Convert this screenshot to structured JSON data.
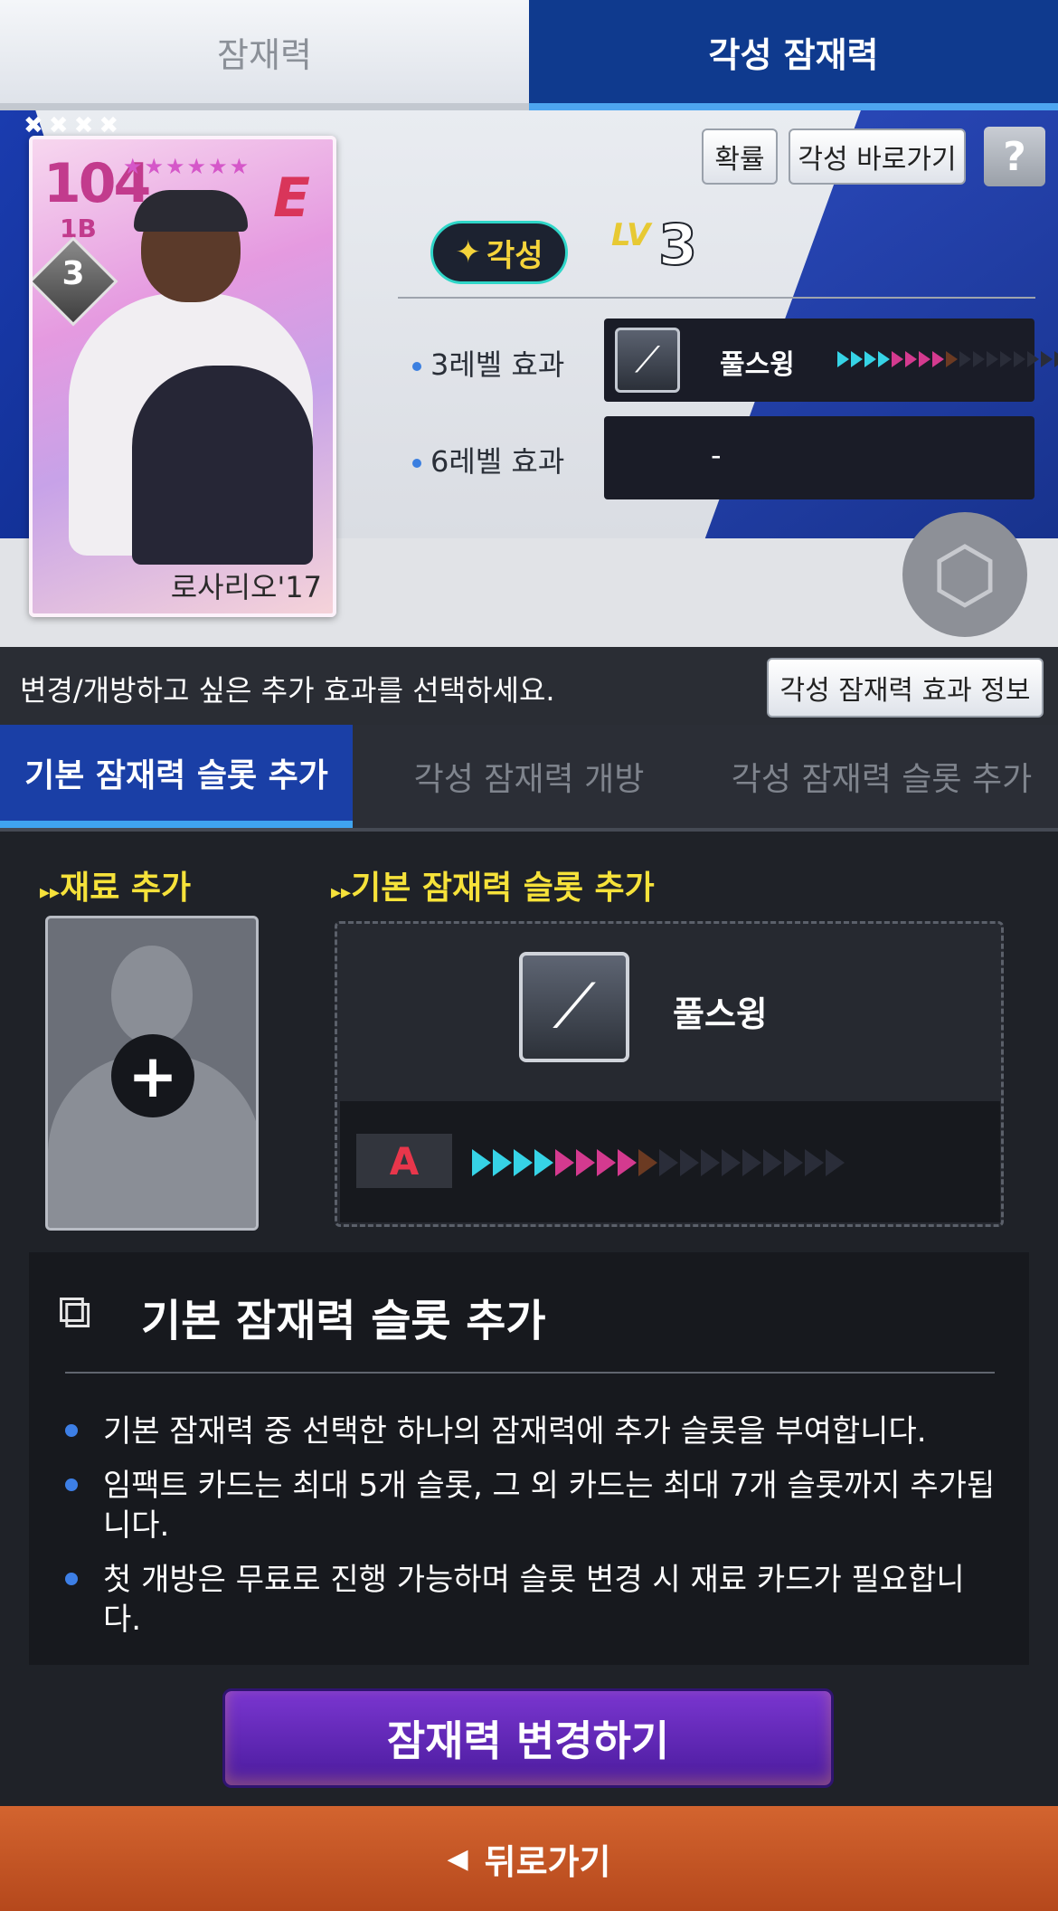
{
  "top_tabs": {
    "potential": "잠재력",
    "awakened_potential": "각성 잠재력"
  },
  "card": {
    "overall": "104",
    "position": "1B",
    "stars": "★★★★★★",
    "awaken_level": "3",
    "team_logo": "E",
    "name": "로사리오'17",
    "marks": "✖✖✖✖"
  },
  "hero": {
    "probability_button": "확률",
    "awaken_shortcut_button": "각성 바로가기",
    "help_button": "?",
    "awaken_badge": "각성",
    "level_prefix": "LV",
    "level_value": "3",
    "effects": [
      {
        "label": "3레벨 효과",
        "skill": "풀스윙",
        "value": "-"
      },
      {
        "label": "6레벨 효과",
        "skill": "",
        "value": "-"
      }
    ]
  },
  "instruction": {
    "text": "변경/개방하고 싶은 추가 효과를 선택하세요.",
    "info_button": "각성 잠재력 효과 정보"
  },
  "sub_tabs": [
    "기본 잠재력 슬롯 추가",
    "각성 잠재력 개방",
    "각성 잠재력 슬롯 추가"
  ],
  "materials": {
    "material_title": "재료 추가",
    "slot_title": "기본 잠재력 슬롯 추가",
    "skill_name": "풀스윙",
    "grade": "A",
    "grade_filled": 9,
    "grade_total": 18
  },
  "description": {
    "title": "기본 잠재력 슬롯 추가",
    "items": [
      "기본 잠재력 중 선택한 하나의 잠재력에 추가 슬롯을 부여합니다.",
      "임팩트 카드는 최대 5개 슬롯, 그 외 카드는 최대 7개 슬롯까지 추가됩니다.",
      "첫 개방은 무료로 진행 가능하며 슬롯 변경 시 재료 카드가 필요합니다."
    ]
  },
  "primary_button": "잠재력 변경하기",
  "back_button": "뒤로가기",
  "colors": {
    "accent": "#1a3fa6",
    "primary": "#5a23b0",
    "back": "#c6552a",
    "highlight": "#f6e23a"
  }
}
